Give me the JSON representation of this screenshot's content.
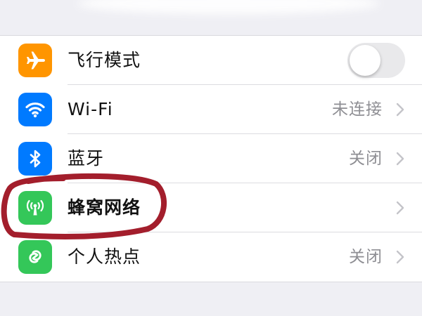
{
  "settings": {
    "items": [
      {
        "label": "飞行模式",
        "type": "toggle",
        "toggle_on": false,
        "icon": "airplane-icon",
        "icon_color": "#ff9500"
      },
      {
        "label": "Wi-Fi",
        "value": "未连接",
        "type": "disclosure",
        "icon": "wifi-icon",
        "icon_color": "#007aff"
      },
      {
        "label": "蓝牙",
        "value": "关闭",
        "type": "disclosure",
        "icon": "bluetooth-icon",
        "icon_color": "#007aff"
      },
      {
        "label": "蜂窝网络",
        "value": "",
        "type": "disclosure",
        "icon": "cellular-antenna-icon",
        "icon_color": "#34c759",
        "highlighted": true
      },
      {
        "label": "个人热点",
        "value": "关闭",
        "type": "disclosure",
        "icon": "personal-hotspot-icon",
        "icon_color": "#34c759"
      }
    ]
  },
  "annotation": {
    "color": "#a31e2c",
    "target": "蜂窝网络"
  }
}
